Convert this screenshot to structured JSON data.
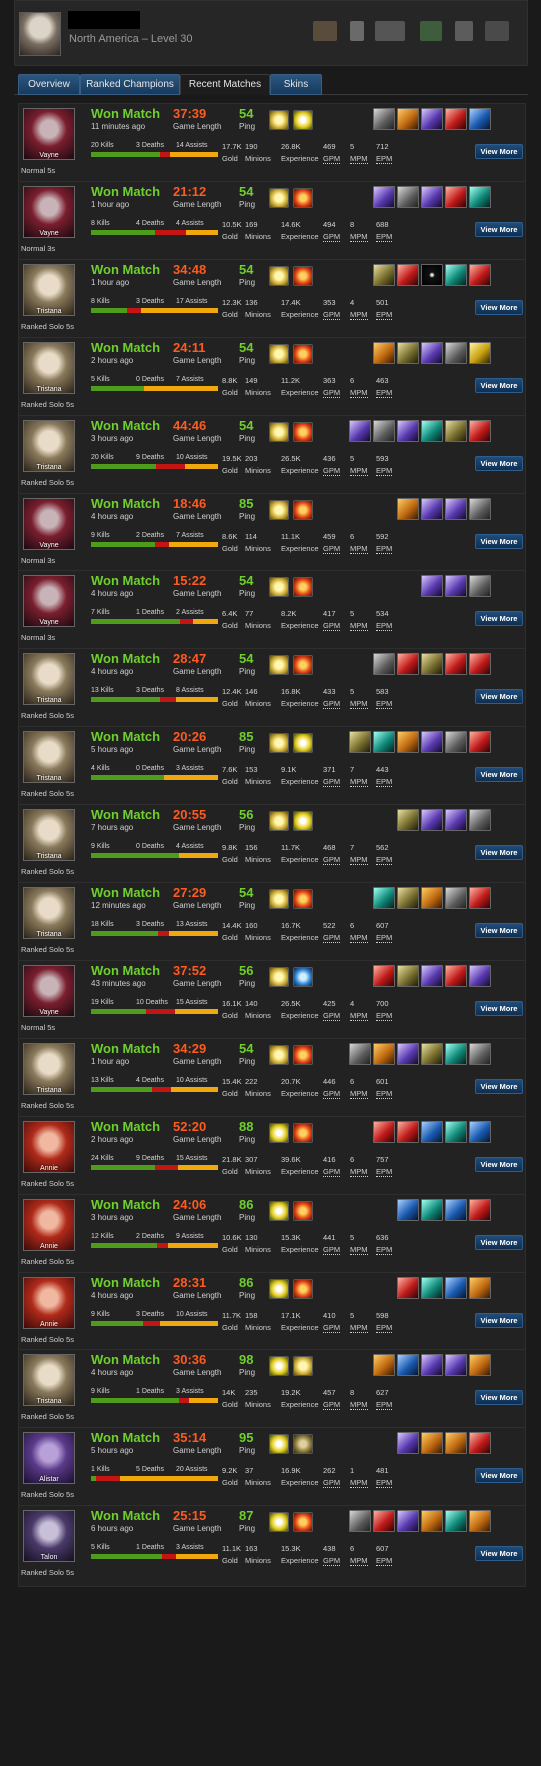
{
  "header": {
    "region_level": "North America – Level 30"
  },
  "tabs": [
    "Overview",
    "Ranked Champions",
    "Recent Matches",
    "Skins"
  ],
  "active_tab": 2,
  "labels": {
    "game_length": "Game Length",
    "ping": "Ping",
    "gold": "Gold",
    "minions": "Minions",
    "experience": "Experience",
    "gpm": "GPM",
    "mpm": "MPM",
    "epm": "EPM",
    "view_more": "View More",
    "kills_suffix": "Kills",
    "deaths_suffix": "Deaths",
    "assists_suffix": "Assists"
  },
  "matches": [
    {
      "champion": "Vayne",
      "result": "Won Match",
      "ago": "11 minutes ago",
      "time": "37:39",
      "ping": "54",
      "kills": "20",
      "deaths": "3",
      "assists": "14",
      "gold": "17.7K",
      "minions": "190",
      "experience": "26.8K",
      "gpm": "469",
      "mpm": "5",
      "epm": "712",
      "queue": "Normal 5s",
      "spells": [
        "flash",
        "heal"
      ],
      "items": [
        "gray",
        "orange",
        "purple",
        "red",
        "blue"
      ]
    },
    {
      "champion": "Vayne",
      "result": "Won Match",
      "ago": "1 hour ago",
      "time": "21:12",
      "ping": "54",
      "kills": "8",
      "deaths": "4",
      "assists": "4",
      "gold": "10.5K",
      "minions": "169",
      "experience": "14.6K",
      "gpm": "494",
      "mpm": "8",
      "epm": "688",
      "queue": "Normal 3s",
      "spells": [
        "flash",
        "ignite"
      ],
      "items": [
        "purple",
        "gray",
        "purple",
        "red",
        "teal"
      ]
    },
    {
      "champion": "Tristana",
      "result": "Won Match",
      "ago": "1 hour ago",
      "time": "34:48",
      "ping": "54",
      "kills": "8",
      "deaths": "3",
      "assists": "17",
      "gold": "12.3K",
      "minions": "136",
      "experience": "17.4K",
      "gpm": "353",
      "mpm": "4",
      "epm": "501",
      "queue": "Ranked Solo 5s",
      "spells": [
        "flash",
        "ignite"
      ],
      "items": [
        "olive",
        "red",
        "dark",
        "teal",
        "red"
      ]
    },
    {
      "champion": "Tristana",
      "result": "Won Match",
      "ago": "2 hours ago",
      "time": "24:11",
      "ping": "54",
      "kills": "5",
      "deaths": "0",
      "assists": "7",
      "gold": "8.8K",
      "minions": "149",
      "experience": "11.2K",
      "gpm": "363",
      "mpm": "6",
      "epm": "463",
      "queue": "Ranked Solo 5s",
      "spells": [
        "flash",
        "ignite"
      ],
      "items": [
        "orange",
        "olive",
        "purple",
        "gray",
        "yellow"
      ]
    },
    {
      "champion": "Tristana",
      "result": "Won Match",
      "ago": "3 hours ago",
      "time": "44:46",
      "ping": "54",
      "kills": "20",
      "deaths": "9",
      "assists": "10",
      "gold": "19.5K",
      "minions": "203",
      "experience": "26.5K",
      "gpm": "436",
      "mpm": "5",
      "epm": "593",
      "queue": "Ranked Solo 5s",
      "spells": [
        "flash",
        "ignite"
      ],
      "items": [
        "purple",
        "gray",
        "purple",
        "teal",
        "olive",
        "red"
      ]
    },
    {
      "champion": "Vayne",
      "result": "Won Match",
      "ago": "4 hours ago",
      "time": "18:46",
      "ping": "85",
      "kills": "9",
      "deaths": "2",
      "assists": "7",
      "gold": "8.6K",
      "minions": "114",
      "experience": "11.1K",
      "gpm": "459",
      "mpm": "6",
      "epm": "592",
      "queue": "Normal 3s",
      "spells": [
        "flash",
        "ignite"
      ],
      "items": [
        "orange",
        "purple",
        "purple",
        "gray"
      ]
    },
    {
      "champion": "Vayne",
      "result": "Won Match",
      "ago": "4 hours ago",
      "time": "15:22",
      "ping": "54",
      "kills": "7",
      "deaths": "1",
      "assists": "2",
      "gold": "6.4K",
      "minions": "77",
      "experience": "8.2K",
      "gpm": "417",
      "mpm": "5",
      "epm": "534",
      "queue": "Normal 3s",
      "spells": [
        "flash",
        "ignite"
      ],
      "items": [
        "purple",
        "purple",
        "gray"
      ]
    },
    {
      "champion": "Tristana",
      "result": "Won Match",
      "ago": "4 hours ago",
      "time": "28:47",
      "ping": "54",
      "kills": "13",
      "deaths": "3",
      "assists": "8",
      "gold": "12.4K",
      "minions": "146",
      "experience": "16.8K",
      "gpm": "433",
      "mpm": "5",
      "epm": "583",
      "queue": "Ranked Solo 5s",
      "spells": [
        "flash",
        "ignite"
      ],
      "items": [
        "gray",
        "red",
        "olive",
        "red",
        "red"
      ]
    },
    {
      "champion": "Tristana",
      "result": "Won Match",
      "ago": "5 hours ago",
      "time": "20:26",
      "ping": "85",
      "kills": "4",
      "deaths": "0",
      "assists": "3",
      "gold": "7.6K",
      "minions": "153",
      "experience": "9.1K",
      "gpm": "371",
      "mpm": "7",
      "epm": "443",
      "queue": "Ranked Solo 5s",
      "spells": [
        "flash",
        "heal"
      ],
      "items": [
        "olive",
        "teal",
        "orange",
        "purple",
        "gray",
        "red"
      ]
    },
    {
      "champion": "Tristana",
      "result": "Won Match",
      "ago": "7 hours ago",
      "time": "20:55",
      "ping": "56",
      "kills": "9",
      "deaths": "0",
      "assists": "4",
      "gold": "9.8K",
      "minions": "156",
      "experience": "11.7K",
      "gpm": "468",
      "mpm": "7",
      "epm": "562",
      "queue": "Ranked Solo 5s",
      "spells": [
        "flash",
        "heal"
      ],
      "items": [
        "olive",
        "purple",
        "purple",
        "gray"
      ]
    },
    {
      "champion": "Tristana",
      "result": "Won Match",
      "ago": "12 minutes ago",
      "time": "27:29",
      "ping": "54",
      "kills": "18",
      "deaths": "3",
      "assists": "13",
      "gold": "14.4K",
      "minions": "160",
      "experience": "16.7K",
      "gpm": "522",
      "mpm": "6",
      "epm": "607",
      "queue": "Ranked Solo 5s",
      "spells": [
        "flash",
        "ignite"
      ],
      "items": [
        "teal",
        "olive",
        "orange",
        "gray",
        "red"
      ]
    },
    {
      "champion": "Vayne",
      "result": "Won Match",
      "ago": "43 minutes ago",
      "time": "37:52",
      "ping": "56",
      "kills": "19",
      "deaths": "10",
      "assists": "15",
      "gold": "16.1K",
      "minions": "140",
      "experience": "26.5K",
      "gpm": "425",
      "mpm": "4",
      "epm": "700",
      "queue": "Normal 5s",
      "spells": [
        "flash",
        "clarity"
      ],
      "items": [
        "red",
        "olive",
        "purple",
        "red",
        "purple"
      ]
    },
    {
      "champion": "Tristana",
      "result": "Won Match",
      "ago": "1 hour ago",
      "time": "34:29",
      "ping": "54",
      "kills": "13",
      "deaths": "4",
      "assists": "10",
      "gold": "15.4K",
      "minions": "222",
      "experience": "20.7K",
      "gpm": "446",
      "mpm": "6",
      "epm": "601",
      "queue": "Ranked Solo 5s",
      "spells": [
        "flash",
        "ignite"
      ],
      "items": [
        "gray",
        "orange",
        "purple",
        "olive",
        "teal",
        "gray"
      ]
    },
    {
      "champion": "Annie",
      "result": "Won Match",
      "ago": "2 hours ago",
      "time": "52:20",
      "ping": "88",
      "kills": "24",
      "deaths": "9",
      "assists": "15",
      "gold": "21.8K",
      "minions": "307",
      "experience": "39.6K",
      "gpm": "416",
      "mpm": "6",
      "epm": "757",
      "queue": "Ranked Solo 5s",
      "spells": [
        "heal",
        "ignite"
      ],
      "items": [
        "red",
        "red",
        "blue",
        "teal",
        "blue"
      ]
    },
    {
      "champion": "Annie",
      "result": "Won Match",
      "ago": "3 hours ago",
      "time": "24:06",
      "ping": "86",
      "kills": "12",
      "deaths": "2",
      "assists": "9",
      "gold": "10.6K",
      "minions": "130",
      "experience": "15.3K",
      "gpm": "441",
      "mpm": "5",
      "epm": "636",
      "queue": "Ranked Solo 5s",
      "spells": [
        "heal",
        "ignite"
      ],
      "items": [
        "blue",
        "teal",
        "blue",
        "red"
      ]
    },
    {
      "champion": "Annie",
      "result": "Won Match",
      "ago": "4 hours ago",
      "time": "28:31",
      "ping": "86",
      "kills": "9",
      "deaths": "3",
      "assists": "10",
      "gold": "11.7K",
      "minions": "158",
      "experience": "17.1K",
      "gpm": "410",
      "mpm": "5",
      "epm": "598",
      "queue": "Ranked Solo 5s",
      "spells": [
        "heal",
        "ignite"
      ],
      "items": [
        "red",
        "teal",
        "blue",
        "orange"
      ]
    },
    {
      "champion": "Tristana",
      "result": "Won Match",
      "ago": "4 hours ago",
      "time": "30:36",
      "ping": "98",
      "kills": "9",
      "deaths": "1",
      "assists": "3",
      "gold": "14K",
      "minions": "235",
      "experience": "19.2K",
      "gpm": "457",
      "mpm": "8",
      "epm": "627",
      "queue": "Ranked Solo 5s",
      "spells": [
        "heal",
        "flash"
      ],
      "items": [
        "orange",
        "blue",
        "purple",
        "purple",
        "orange"
      ]
    },
    {
      "champion": "Alistar",
      "result": "Won Match",
      "ago": "5 hours ago",
      "time": "35:14",
      "ping": "95",
      "kills": "1",
      "deaths": "5",
      "assists": "20",
      "gold": "9.2K",
      "minions": "37",
      "experience": "16.9K",
      "gpm": "262",
      "mpm": "1",
      "epm": "481",
      "queue": "Ranked Solo 5s",
      "spells": [
        "heal",
        "olive"
      ],
      "items": [
        "purple",
        "orange",
        "orange",
        "red"
      ]
    },
    {
      "champion": "Talon",
      "result": "Won Match",
      "ago": "6 hours ago",
      "time": "25:15",
      "ping": "87",
      "kills": "5",
      "deaths": "1",
      "assists": "3",
      "gold": "11.1K",
      "minions": "163",
      "experience": "15.3K",
      "gpm": "438",
      "mpm": "6",
      "epm": "607",
      "queue": "Ranked Solo 5s",
      "spells": [
        "heal",
        "ignite"
      ],
      "items": [
        "gray",
        "red",
        "purple",
        "orange",
        "teal",
        "orange"
      ]
    }
  ],
  "colors": {
    "won": "#6fcf2e",
    "time": "#ff5a1f",
    "kills_bar": "#4f9b1c",
    "deaths_bar": "#c41515",
    "assists_bar": "#f0a80f"
  }
}
